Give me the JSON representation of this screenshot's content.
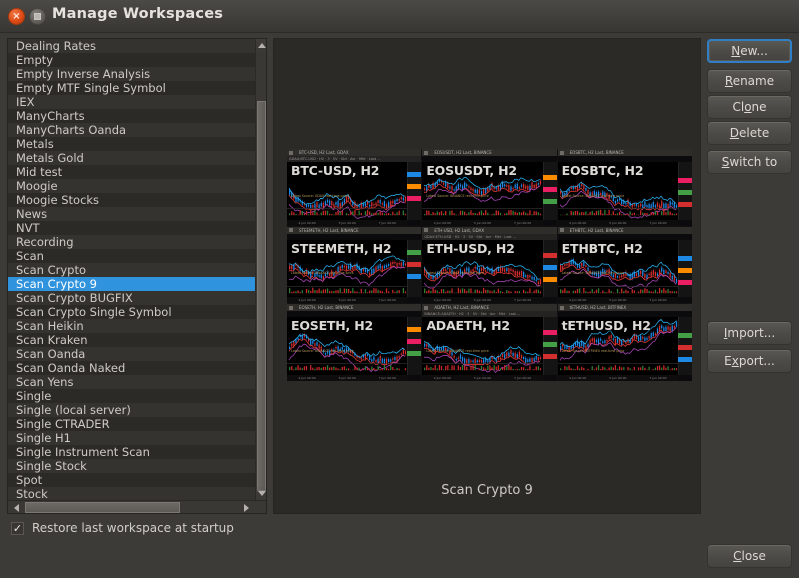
{
  "window": {
    "title": "Manage Workspaces",
    "close_icon": "close-icon",
    "maximize_icon": "maximize-icon"
  },
  "workspace_list": {
    "items": [
      "Dealing Rates",
      "Empty",
      "Empty Inverse Analysis",
      "Empty MTF Single Symbol",
      "IEX",
      "ManyCharts",
      "ManyCharts Oanda",
      "Metals",
      "Metals Gold",
      "Mid test",
      "Moogie",
      "Moogie Stocks",
      "News",
      "NVT",
      "Recording",
      "Scan",
      "Scan Crypto",
      "Scan Crypto 9",
      "Scan Crypto BUGFIX",
      "Scan Crypto Single Symbol",
      "Scan Heikin",
      "Scan Kraken",
      "Scan Oanda",
      "Scan Oanda Naked",
      "Scan Yens",
      "Single",
      "Single (local server)",
      "Single CTRADER",
      "Single H1",
      "Single Instrument Scan",
      "Single Stock",
      "Spot",
      "Stock"
    ],
    "selected": "Scan Crypto 9",
    "selected_index": 17,
    "selection_color": "#2f93dd",
    "scroll_up_icon": "chevron-up-icon",
    "scroll_down_icon": "chevron-down-icon",
    "scroll_left_icon": "chevron-left-icon",
    "scroll_right_icon": "chevron-right-icon"
  },
  "restore_option": {
    "label": "Restore last workspace at startup",
    "checked": true,
    "check_glyph": "✓"
  },
  "preview": {
    "caption": "Scan Crypto 9",
    "charts": [
      {
        "header": "BTC-USD, H2 Last, GDAX",
        "toolbar": "GDAX:BTC-USD  ·  H2  ·  3  ·  SV  ·  Std  ·  Avr  ·  Mkt  ·  Last  ...",
        "label": "BTC-USD, H2",
        "source": "Latest Source: GDAX real-time price"
      },
      {
        "header": "EOSUSDT, H2 Last, BINANCE",
        "toolbar": "",
        "label": "EOSUSDT, H2",
        "source": "Latest Source: BINANCE real-time price"
      },
      {
        "header": "EOSBTC, H2 Last, BINANCE",
        "toolbar": "",
        "label": "EOSBTC, H2",
        "source": "Latest Source: BINANCE real-time price"
      },
      {
        "header": "STEEMETH, H2 Last, BINANCE",
        "toolbar": "",
        "label": "STEEMETH, H2",
        "source": "Latest Source: BINANCE real-time price"
      },
      {
        "header": "ETH-USD, H2 Last, GDAX",
        "toolbar": "GDAX:ETH-USD  ·  H2  ·  3  ·  SV  ·  Std  ·  Avr  ·  Mkt  ·  Last  ...",
        "label": "ETH-USD, H2",
        "source": "Latest Source: GDAX real-time price"
      },
      {
        "header": "ETHBTC, H2 Last, BINANCE",
        "toolbar": "",
        "label": "ETHBTC, H2",
        "source": "Latest Source: BINANCE real-time price"
      },
      {
        "header": "EOSETH, H2 Last, BINANCE",
        "toolbar": "",
        "label": "EOSETH, H2",
        "source": "Latest Source: BINANCE real-time price"
      },
      {
        "header": "ADAETH, H2 Last, BINANCE",
        "toolbar": "BINANCE:ADAETH  ·  H2  ·  3  ·  SV  ·  Std  ·  Avr  ·  Mkt  ·  Last  ...",
        "label": "ADAETH, H2",
        "source": "Latest Source: BINANCE real-time price"
      },
      {
        "header": "tETHUSD, H2 Last, BITFINEX",
        "toolbar": "",
        "label": "tETHUSD, H2",
        "source": "Latest Source: BITFINEX real-time price"
      }
    ],
    "time_labels": [
      "4 Jun 00:00",
      "5 Jun 00:00",
      "7 Jun 00:00"
    ]
  },
  "buttons": {
    "new": {
      "pre": "",
      "key": "N",
      "post": "ew..."
    },
    "rename": {
      "pre": "",
      "key": "R",
      "post": "ename"
    },
    "clone": {
      "pre": "Cl",
      "key": "o",
      "post": "ne"
    },
    "delete": {
      "pre": "",
      "key": "D",
      "post": "elete"
    },
    "switch_to": {
      "pre": "",
      "key": "S",
      "post": "witch to"
    },
    "import": {
      "pre": "",
      "key": "I",
      "post": "mport..."
    },
    "export": {
      "pre": "E",
      "key": "x",
      "post": "port..."
    },
    "close": {
      "pre": "",
      "key": "C",
      "post": "lose"
    }
  }
}
